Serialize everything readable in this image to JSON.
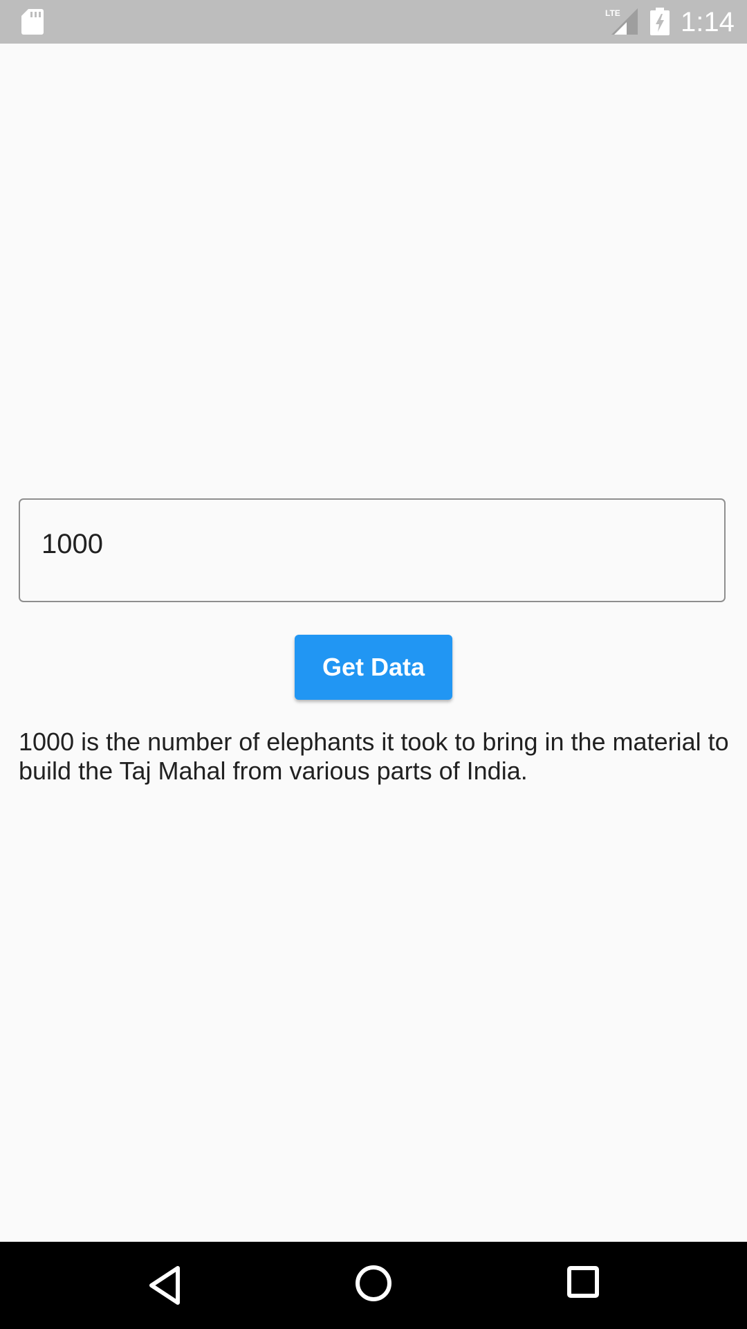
{
  "status_bar": {
    "time": "1:14",
    "network_label": "LTE",
    "icons": [
      "sd-card-icon",
      "lte-signal-icon",
      "battery-charging-icon"
    ]
  },
  "input": {
    "value": "1000"
  },
  "button": {
    "label": "Get Data",
    "color": "#2196f3"
  },
  "result": {
    "text": "1000 is the number of elephants it took to bring in the material to build the Taj Mahal from various parts of India."
  },
  "nav_bar": {
    "icons": [
      "back-icon",
      "home-icon",
      "recents-icon"
    ]
  }
}
